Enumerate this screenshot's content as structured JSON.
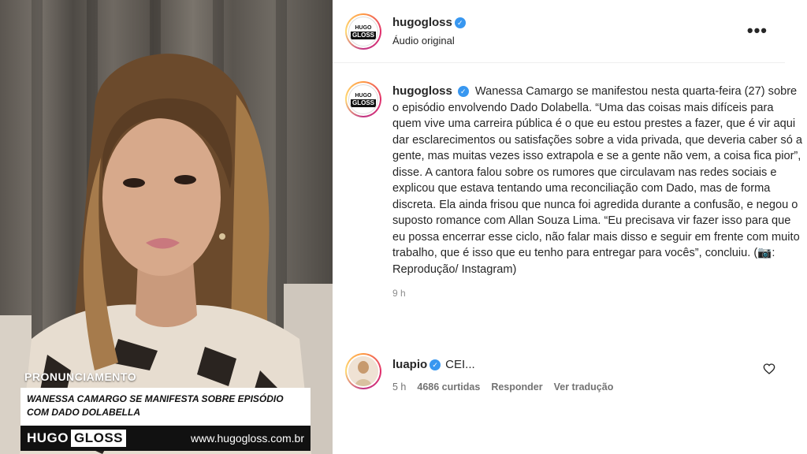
{
  "video": {
    "tag": "PRONUNCIAMENTO",
    "headline": "WANESSA CAMARGO SE MANIFESTA SOBRE EPISÓDIO COM DADO DOLABELLA",
    "logo_hugo": "HUGO",
    "logo_gloss": "GLOSS",
    "site": "www.hugogloss.com.br"
  },
  "post": {
    "username": "hugogloss",
    "subline": "Áudio original",
    "more_label": "•••",
    "avatar_hugo": "HUGO",
    "avatar_gloss": "GLOSS",
    "caption_username": "hugogloss",
    "caption_text": "Wanessa Camargo se manifestou nesta quarta-feira (27) sobre o episódio envolvendo Dado Dolabella. “Uma das coisas mais difíceis para quem vive uma carreira pública é o que eu estou prestes a fazer, que é vir aqui dar esclarecimentos ou satisfações sobre a vida privada, que deveria caber só a gente, mas muitas vezes isso extrapola e se a gente não vem, a coisa fica pior”, disse. A cantora falou sobre os rumores que circulavam nas redes sociais e explicou que estava tentando uma reconciliação com Dado, mas de forma discreta. Ela ainda frisou que nunca foi agredida durante a confusão, e negou o suposto romance com Allan Souza Lima. “Eu precisava vir fazer isso para que eu possa encerrar esse ciclo, não falar mais disso e seguir em frente com muito trabalho, que é isso que eu tenho para entregar para vocês”, concluiu. (📷: Reprodução/ Instagram)",
    "caption_time": "9 h"
  },
  "comment": {
    "username": "luapio",
    "text": "CEI...",
    "time": "5 h",
    "likes": "4686 curtidas",
    "reply": "Responder",
    "translate": "Ver tradução"
  },
  "colors": {
    "verified": "#3897f0",
    "meta": "#737373"
  }
}
